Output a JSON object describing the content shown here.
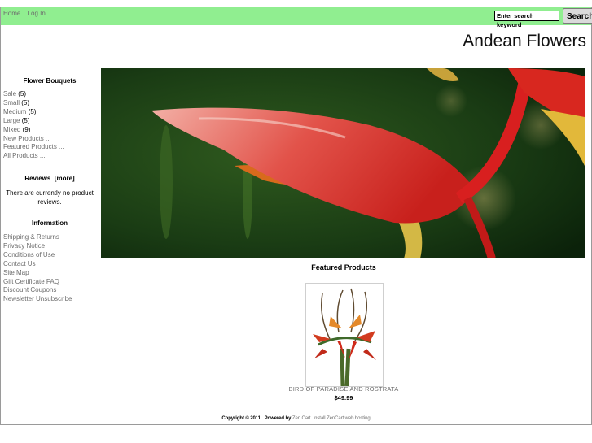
{
  "topbar": {
    "nav": [
      "Home",
      "Log In"
    ],
    "search_placeholder": "Enter search keyword",
    "search_button": "Search",
    "color": "#90ee90"
  },
  "logo": "Andean Flowers",
  "sidebar": {
    "bouquets": {
      "title": "Flower Bouquets",
      "items": [
        {
          "label": "Sale",
          "count": "(5)"
        },
        {
          "label": "Small",
          "count": "(5)"
        },
        {
          "label": "Medium",
          "count": "(5)"
        },
        {
          "label": "Large",
          "count": "(5)"
        },
        {
          "label": "Mixed",
          "count": "(9)"
        },
        {
          "label": "New Products ...",
          "count": ""
        },
        {
          "label": "Featured Products ...",
          "count": ""
        },
        {
          "label": "All Products ...",
          "count": ""
        }
      ]
    },
    "reviews": {
      "title": "Reviews",
      "more": "[more]",
      "text": "There are currently no product reviews."
    },
    "information": {
      "title": "Information",
      "items": [
        "Shipping & Returns",
        "Privacy Notice",
        "Conditions of Use",
        "Contact Us",
        "Site Map",
        "Gift Certificate FAQ",
        "Discount Coupons",
        "Newsletter Unsubscribe"
      ]
    }
  },
  "main": {
    "featured_title": "Featured Products",
    "product": {
      "name": "BIRD OF PARADISE AND ROSTRATA",
      "price": "$49.99"
    }
  },
  "footer": {
    "copyright": "Copyright © 2011 . Powered by",
    "zencart": "Zen Cart",
    "install": ". Install ZenCart web hosting"
  }
}
